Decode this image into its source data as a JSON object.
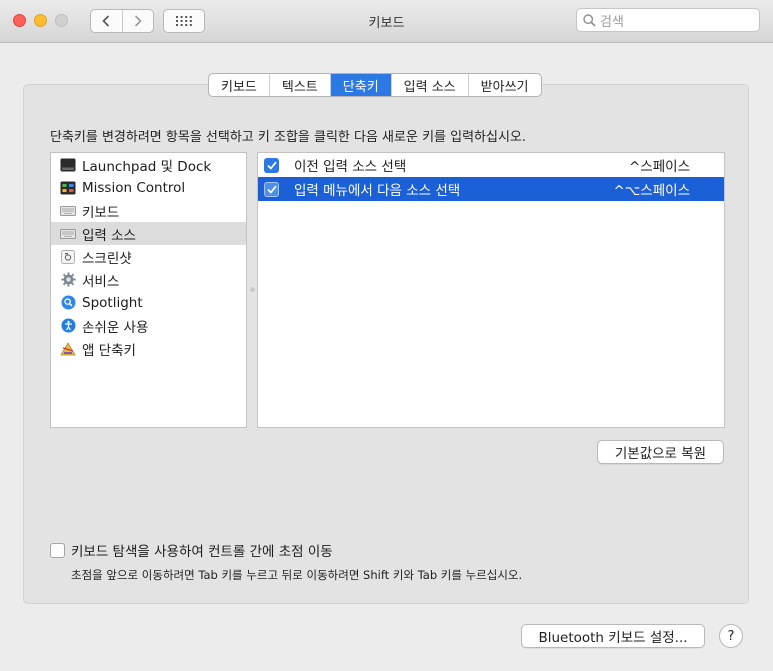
{
  "window": {
    "title": "키보드"
  },
  "search": {
    "placeholder": "검색"
  },
  "tabs": [
    {
      "label": "키보드"
    },
    {
      "label": "텍스트"
    },
    {
      "label": "단축키"
    },
    {
      "label": "입력 소스"
    },
    {
      "label": "받아쓰기"
    }
  ],
  "active_tab": "단축키",
  "instruction": "단축키를 변경하려면 항목을 선택하고 키 조합을 클릭한 다음 새로운 키를 입력하십시오.",
  "categories": [
    {
      "label": "Launchpad 및 Dock",
      "icon": "launchpad-dock-icon"
    },
    {
      "label": "Mission Control",
      "icon": "mission-control-icon"
    },
    {
      "label": "키보드",
      "icon": "keyboard-icon"
    },
    {
      "label": "입력 소스",
      "icon": "keyboard-icon",
      "selected": true
    },
    {
      "label": "스크린샷",
      "icon": "screenshot-icon"
    },
    {
      "label": "서비스",
      "icon": "gear-icon"
    },
    {
      "label": "Spotlight",
      "icon": "spotlight-icon"
    },
    {
      "label": "손쉬운 사용",
      "icon": "accessibility-icon"
    },
    {
      "label": "앱 단축키",
      "icon": "app-shortcuts-icon"
    }
  ],
  "shortcuts": [
    {
      "label": "이전 입력 소스 선택",
      "key": "^스페이스",
      "checked": true,
      "selected": false
    },
    {
      "label": "입력 메뉴에서 다음 소스 선택",
      "key": "^⌥스페이스",
      "checked": true,
      "selected": true
    }
  ],
  "buttons": {
    "restore_defaults": "기본값으로 복원",
    "bluetooth_setup": "Bluetooth 키보드 설정...",
    "help": "?"
  },
  "keyboard_navigation": {
    "label": "키보드 탐색을 사용하여 컨트롤 간에 초점 이동",
    "checked": false,
    "hint": "초점을 앞으로 이동하려면 Tab 키를 누르고 뒤로 이동하려면 Shift 키와 Tab 키를 누르십시오."
  },
  "colors": {
    "accent": "#2d79e4",
    "selection": "#1b60d6",
    "close": "#fe5f57",
    "minimize": "#febc2e"
  }
}
